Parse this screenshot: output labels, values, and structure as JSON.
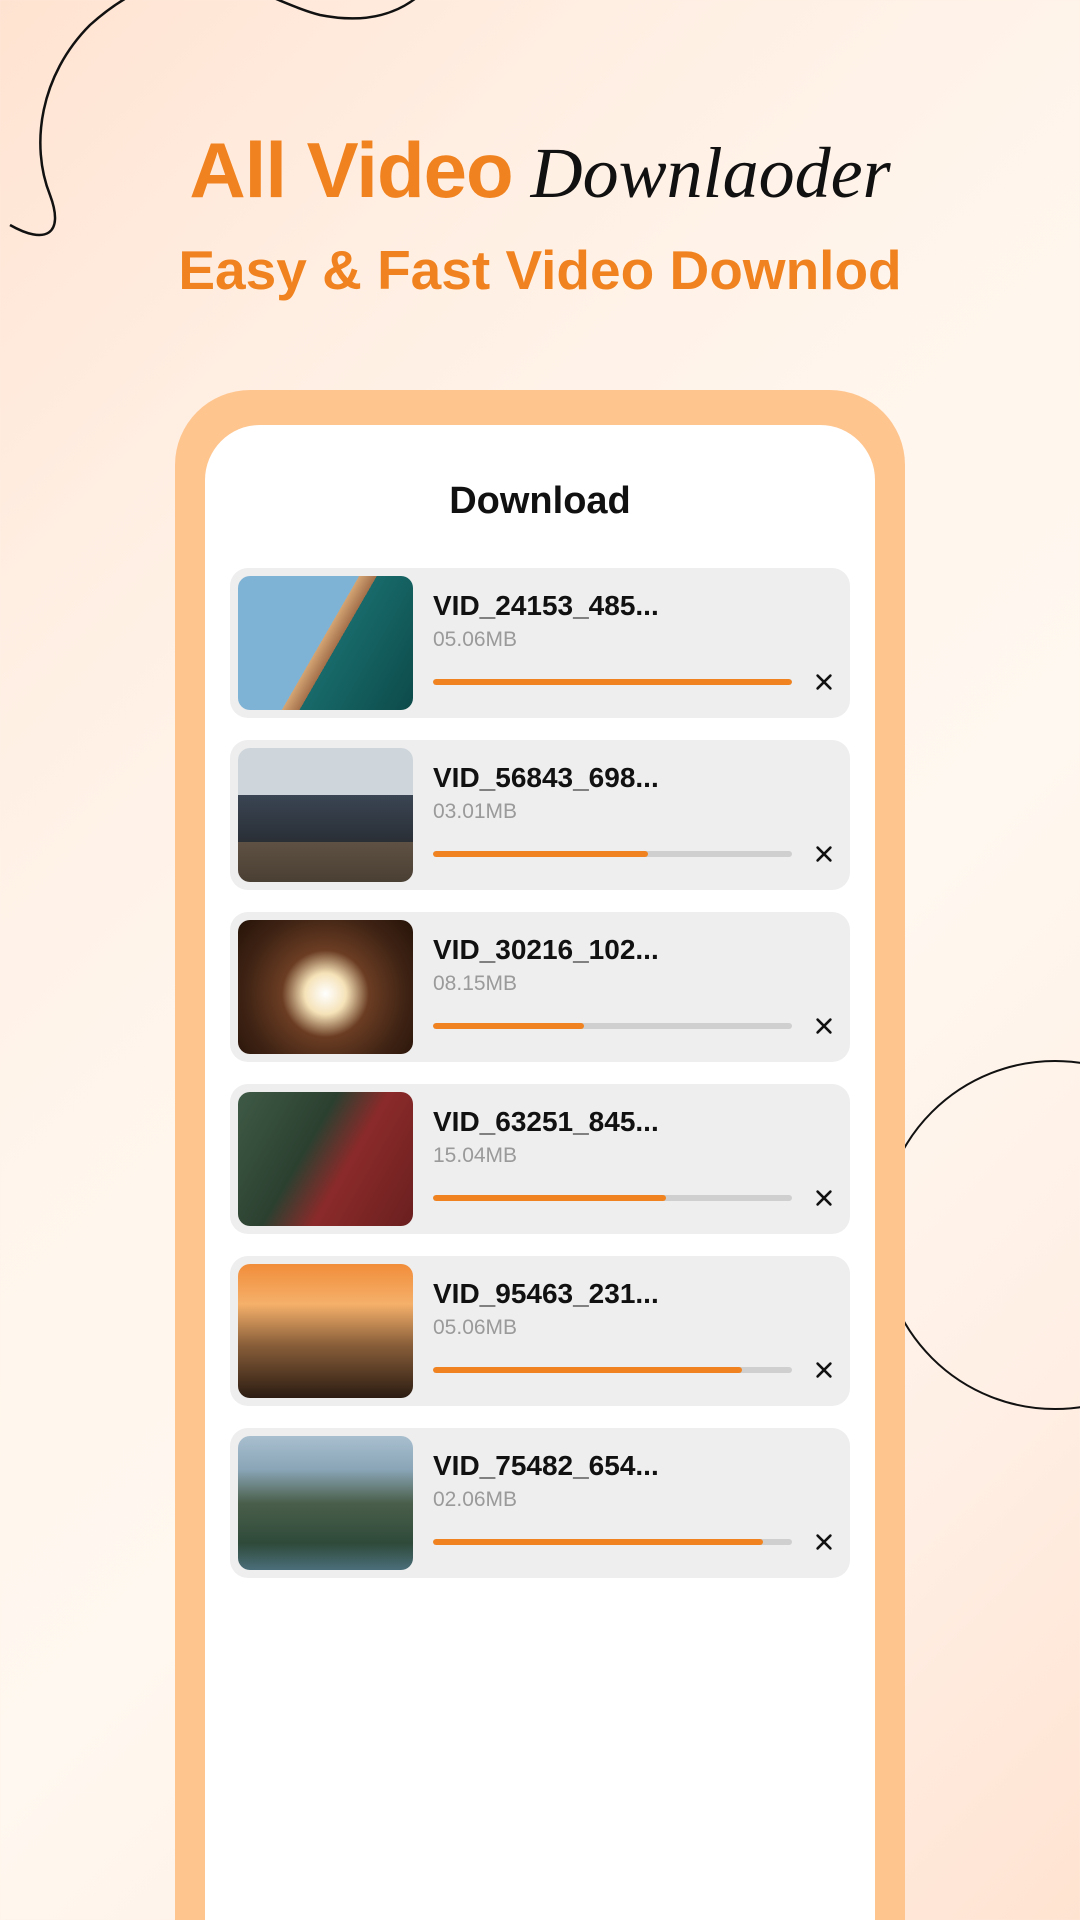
{
  "hero": {
    "title_part1": "All Video",
    "title_part2": "Downlaoder",
    "subtitle": "Easy & Fast Video Downlod"
  },
  "screen": {
    "title": "Download"
  },
  "downloads": [
    {
      "name": "VID_24153_485...",
      "size": "05.06MB",
      "progress": 100
    },
    {
      "name": "VID_56843_698...",
      "size": "03.01MB",
      "progress": 60
    },
    {
      "name": "VID_30216_102...",
      "size": "08.15MB",
      "progress": 42
    },
    {
      "name": "VID_63251_845...",
      "size": "15.04MB",
      "progress": 65
    },
    {
      "name": "VID_95463_231...",
      "size": "05.06MB",
      "progress": 86
    },
    {
      "name": "VID_75482_654...",
      "size": "02.06MB",
      "progress": 92
    }
  ],
  "colors": {
    "accent": "#f0831f"
  }
}
